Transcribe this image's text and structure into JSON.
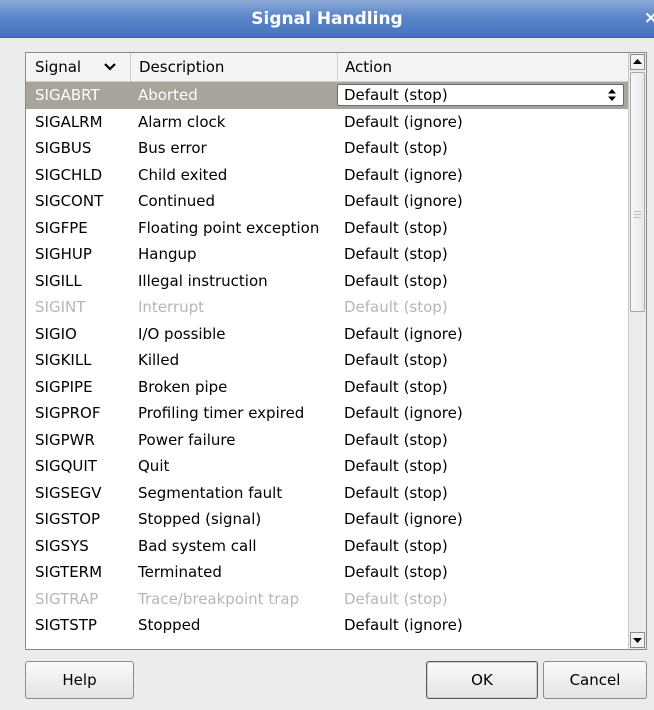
{
  "window": {
    "title": "Signal Handling",
    "close_glyph": "×"
  },
  "table": {
    "headers": {
      "signal": "Signal",
      "description": "Description",
      "action": "Action"
    },
    "selected_row": 0,
    "rows": [
      {
        "signal": "SIGABRT",
        "description": "Aborted",
        "action": "Default (stop)",
        "state": "selected"
      },
      {
        "signal": "SIGALRM",
        "description": "Alarm clock",
        "action": "Default (ignore)",
        "state": "normal"
      },
      {
        "signal": "SIGBUS",
        "description": "Bus error",
        "action": "Default (stop)",
        "state": "normal"
      },
      {
        "signal": "SIGCHLD",
        "description": "Child exited",
        "action": "Default (ignore)",
        "state": "normal"
      },
      {
        "signal": "SIGCONT",
        "description": "Continued",
        "action": "Default (ignore)",
        "state": "normal"
      },
      {
        "signal": "SIGFPE",
        "description": "Floating point exception",
        "action": "Default (stop)",
        "state": "normal"
      },
      {
        "signal": "SIGHUP",
        "description": "Hangup",
        "action": "Default (stop)",
        "state": "normal"
      },
      {
        "signal": "SIGILL",
        "description": "Illegal instruction",
        "action": "Default (stop)",
        "state": "normal"
      },
      {
        "signal": "SIGINT",
        "description": "Interrupt",
        "action": "Default (stop)",
        "state": "disabled"
      },
      {
        "signal": "SIGIO",
        "description": "I/O possible",
        "action": "Default (ignore)",
        "state": "normal"
      },
      {
        "signal": "SIGKILL",
        "description": "Killed",
        "action": "Default (stop)",
        "state": "normal"
      },
      {
        "signal": "SIGPIPE",
        "description": "Broken pipe",
        "action": "Default (stop)",
        "state": "normal"
      },
      {
        "signal": "SIGPROF",
        "description": "Profiling timer expired",
        "action": "Default (ignore)",
        "state": "normal"
      },
      {
        "signal": "SIGPWR",
        "description": "Power failure",
        "action": "Default (stop)",
        "state": "normal"
      },
      {
        "signal": "SIGQUIT",
        "description": "Quit",
        "action": "Default (stop)",
        "state": "normal"
      },
      {
        "signal": "SIGSEGV",
        "description": "Segmentation fault",
        "action": "Default (stop)",
        "state": "normal"
      },
      {
        "signal": "SIGSTOP",
        "description": "Stopped (signal)",
        "action": "Default (ignore)",
        "state": "normal"
      },
      {
        "signal": "SIGSYS",
        "description": "Bad system call",
        "action": "Default (stop)",
        "state": "normal"
      },
      {
        "signal": "SIGTERM",
        "description": "Terminated",
        "action": "Default (stop)",
        "state": "normal"
      },
      {
        "signal": "SIGTRAP",
        "description": "Trace/breakpoint trap",
        "action": "Default (stop)",
        "state": "disabled"
      },
      {
        "signal": "SIGTSTP",
        "description": "Stopped",
        "action": "Default (ignore)",
        "state": "normal"
      }
    ]
  },
  "buttons": {
    "help": "Help",
    "ok": "OK",
    "cancel": "Cancel"
  },
  "colors": {
    "title_bar": "#5b86c8",
    "selected_row": "#a8a49c",
    "disabled_text": "#b6b6b6"
  },
  "icons": {
    "sort": "chevron-down-icon",
    "combo": "updown-arrows-icon",
    "scroll_up": "arrow-up-icon",
    "scroll_down": "arrow-down-icon"
  }
}
